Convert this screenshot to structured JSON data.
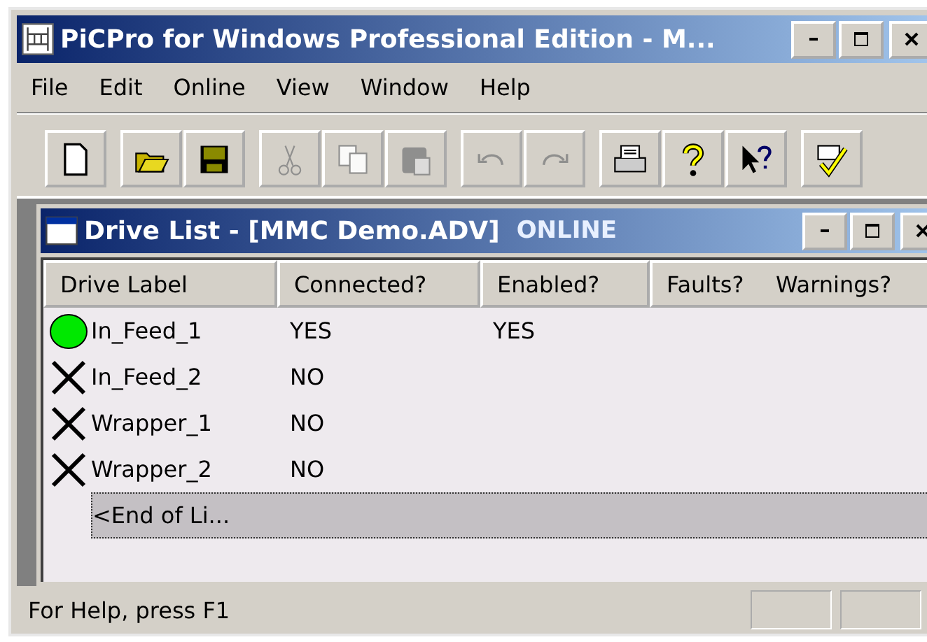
{
  "window": {
    "title": "PiCPro for Windows Professional Edition - M..."
  },
  "menu": [
    {
      "label": "File"
    },
    {
      "label": "Edit"
    },
    {
      "label": "Online"
    },
    {
      "label": "View"
    },
    {
      "label": "Window"
    },
    {
      "label": "Help"
    }
  ],
  "toolbar": [
    [
      {
        "kind": "new",
        "disabled": false
      }
    ],
    [
      {
        "kind": "open",
        "disabled": false
      },
      {
        "kind": "save",
        "disabled": false
      }
    ],
    [
      {
        "kind": "cut",
        "disabled": true
      },
      {
        "kind": "copy",
        "disabled": true
      },
      {
        "kind": "paste",
        "disabled": true
      }
    ],
    [
      {
        "kind": "undo",
        "disabled": true
      },
      {
        "kind": "redo",
        "disabled": true
      }
    ],
    [
      {
        "kind": "print",
        "disabled": false
      },
      {
        "kind": "help",
        "disabled": false
      },
      {
        "kind": "context-help",
        "disabled": false
      }
    ],
    [
      {
        "kind": "check",
        "disabled": false
      }
    ]
  ],
  "child_window": {
    "title": "Drive List - [MMC Demo.ADV]",
    "mode": "ONLINE"
  },
  "table": {
    "columns": [
      "Drive Label",
      "Connected?",
      "Enabled?",
      "Faults?",
      "Warnings?"
    ],
    "rows": [
      {
        "kind": "drive",
        "online": true,
        "label": "In_Feed_1",
        "connected": "YES",
        "enabled": "YES",
        "selected": false
      },
      {
        "kind": "drive",
        "online": false,
        "label": "In_Feed_2",
        "connected": "NO",
        "selected": false
      },
      {
        "kind": "drive",
        "online": false,
        "label": "Wrapper_1",
        "connected": "NO",
        "selected": false
      },
      {
        "kind": "drive",
        "online": false,
        "label": "Wrapper_2",
        "connected": "NO",
        "selected": false
      },
      {
        "kind": "end",
        "label": "<End of Li...",
        "selected": true
      }
    ]
  },
  "status_bar": {
    "text": "For Help, press F1"
  }
}
